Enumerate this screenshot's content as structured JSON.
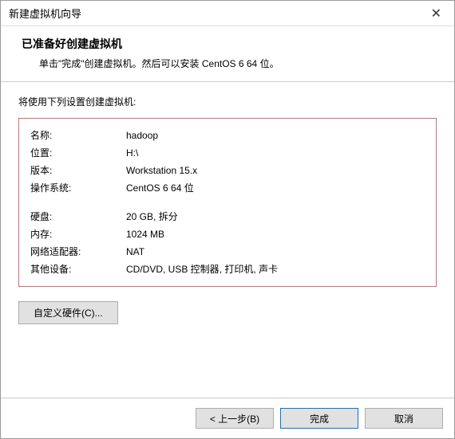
{
  "window": {
    "title": "新建虚拟机向导"
  },
  "header": {
    "headline": "已准备好创建虚拟机",
    "subtext": "单击\"完成\"创建虚拟机。然后可以安装 CentOS 6 64 位。"
  },
  "content": {
    "intro": "将使用下列设置创建虚拟机:",
    "specs": {
      "name_label": "名称:",
      "name_value": "hadoop",
      "location_label": "位置:",
      "location_value": "H:\\",
      "version_label": "版本:",
      "version_value": "Workstation 15.x",
      "os_label": "操作系统:",
      "os_value": "CentOS 6 64 位",
      "disk_label": "硬盘:",
      "disk_value": "20 GB, 拆分",
      "memory_label": "内存:",
      "memory_value": "1024 MB",
      "netadapter_label": "网络适配器:",
      "netadapter_value": "NAT",
      "other_label": "其他设备:",
      "other_value": "CD/DVD, USB 控制器, 打印机, 声卡"
    },
    "customize_hw_btn": "自定义硬件(C)..."
  },
  "footer": {
    "back": "< 上一步(B)",
    "finish": "完成",
    "cancel": "取消"
  }
}
